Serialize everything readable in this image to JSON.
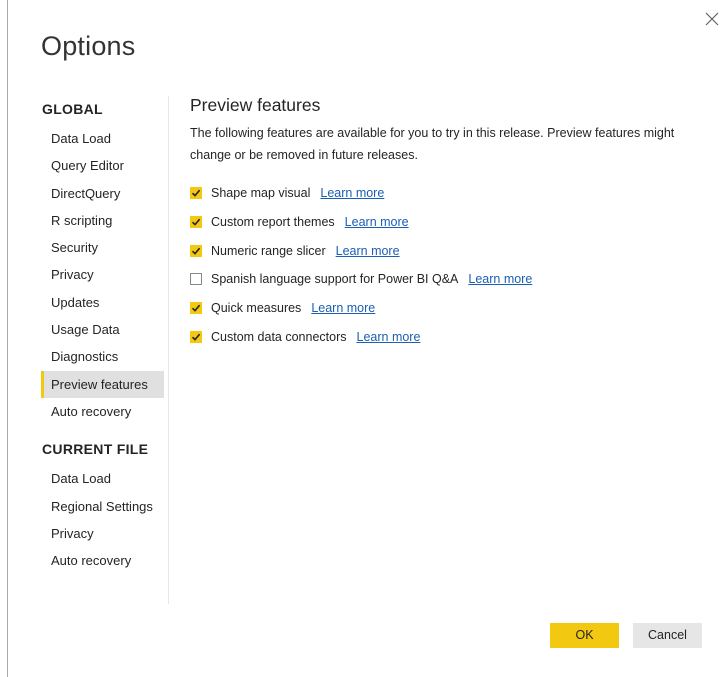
{
  "dialog": {
    "title": "Options",
    "close_icon": "close-icon"
  },
  "nav": {
    "global_header": "GLOBAL",
    "global_items": [
      {
        "label": "Data Load"
      },
      {
        "label": "Query Editor"
      },
      {
        "label": "DirectQuery"
      },
      {
        "label": "R scripting"
      },
      {
        "label": "Security"
      },
      {
        "label": "Privacy"
      },
      {
        "label": "Updates"
      },
      {
        "label": "Usage Data"
      },
      {
        "label": "Diagnostics"
      },
      {
        "label": "Preview features",
        "selected": true
      },
      {
        "label": "Auto recovery"
      }
    ],
    "current_file_header": "CURRENT FILE",
    "current_file_items": [
      {
        "label": "Data Load"
      },
      {
        "label": "Regional Settings"
      },
      {
        "label": "Privacy"
      },
      {
        "label": "Auto recovery"
      }
    ]
  },
  "content": {
    "title": "Preview features",
    "description": "The following features are available for you to try in this release. Preview features might change or be removed in future releases.",
    "features": [
      {
        "label": "Shape map visual",
        "checked": true,
        "link": "Learn more"
      },
      {
        "label": "Custom report themes",
        "checked": true,
        "link": "Learn more"
      },
      {
        "label": "Numeric range slicer",
        "checked": true,
        "link": "Learn more"
      },
      {
        "label": "Spanish language support for Power BI Q&A",
        "checked": false,
        "link": "Learn more"
      },
      {
        "label": "Quick measures",
        "checked": true,
        "link": "Learn more"
      },
      {
        "label": "Custom data connectors",
        "checked": true,
        "link": "Learn more"
      }
    ]
  },
  "buttons": {
    "ok": "OK",
    "cancel": "Cancel"
  },
  "colors": {
    "accent": "#f2c811",
    "link": "#1a5fb4",
    "selected_bg": "#e0e0e0"
  }
}
